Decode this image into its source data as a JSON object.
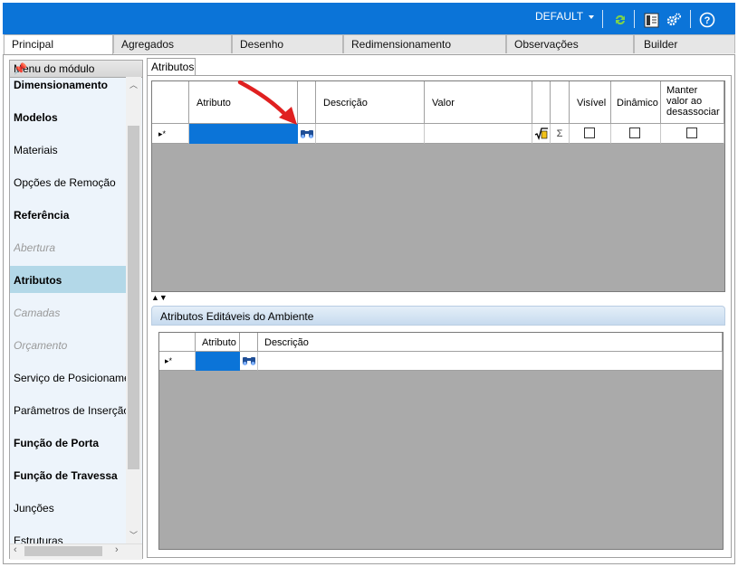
{
  "topbar": {
    "profile_label": "DEFAULT",
    "icons": [
      "refresh-icon",
      "layout-panel-icon",
      "settings-gears-icon",
      "help-icon"
    ],
    "bg_color": "#0b74d8"
  },
  "tabs": [
    {
      "label": "Principal",
      "active": true
    },
    {
      "label": "Agregados"
    },
    {
      "label": "Desenho"
    },
    {
      "label": "Redimensionamento"
    },
    {
      "label": "Observações"
    },
    {
      "label": "Builder"
    }
  ],
  "menu": {
    "title": "Menu do módulo",
    "items": [
      {
        "label": "Dimensionamento",
        "style": "bold"
      },
      {
        "label": "Modelos",
        "style": "bold"
      },
      {
        "label": "Materiais",
        "style": "normal"
      },
      {
        "label": "Opções de Remoção",
        "style": "normal"
      },
      {
        "label": "Referência",
        "style": "bold"
      },
      {
        "label": "Abertura",
        "style": "disabled"
      },
      {
        "label": "Atributos",
        "style": "bold",
        "selected": true
      },
      {
        "label": "Camadas",
        "style": "disabled"
      },
      {
        "label": "Orçamento",
        "style": "disabled"
      },
      {
        "label": "Serviço de Posicionamento",
        "style": "normal"
      },
      {
        "label": "Parâmetros de Inserção",
        "style": "normal"
      },
      {
        "label": "Função de Porta",
        "style": "bold"
      },
      {
        "label": "Função de Travessa",
        "style": "bold"
      },
      {
        "label": "Junções",
        "style": "normal"
      },
      {
        "label": "Estruturas",
        "style": "normal"
      }
    ]
  },
  "attributes_tab": {
    "label": "Atributos"
  },
  "grid1": {
    "columns": [
      "Atributo",
      "Descrição",
      "Valor",
      "Visível",
      "Dinâmico",
      "Manter valor ao desassociar"
    ],
    "new_row_marker": "▸*"
  },
  "env_section": {
    "title": "Atributos Editáveis do Ambiente",
    "columns": [
      "Atributo",
      "Descrição"
    ],
    "new_row_marker": "▸*"
  },
  "colors": {
    "selection": "#0b74d8",
    "grid_empty": "#aaaaaa",
    "menu_selected": "#b3d8e8",
    "arrow": "#e02020"
  }
}
